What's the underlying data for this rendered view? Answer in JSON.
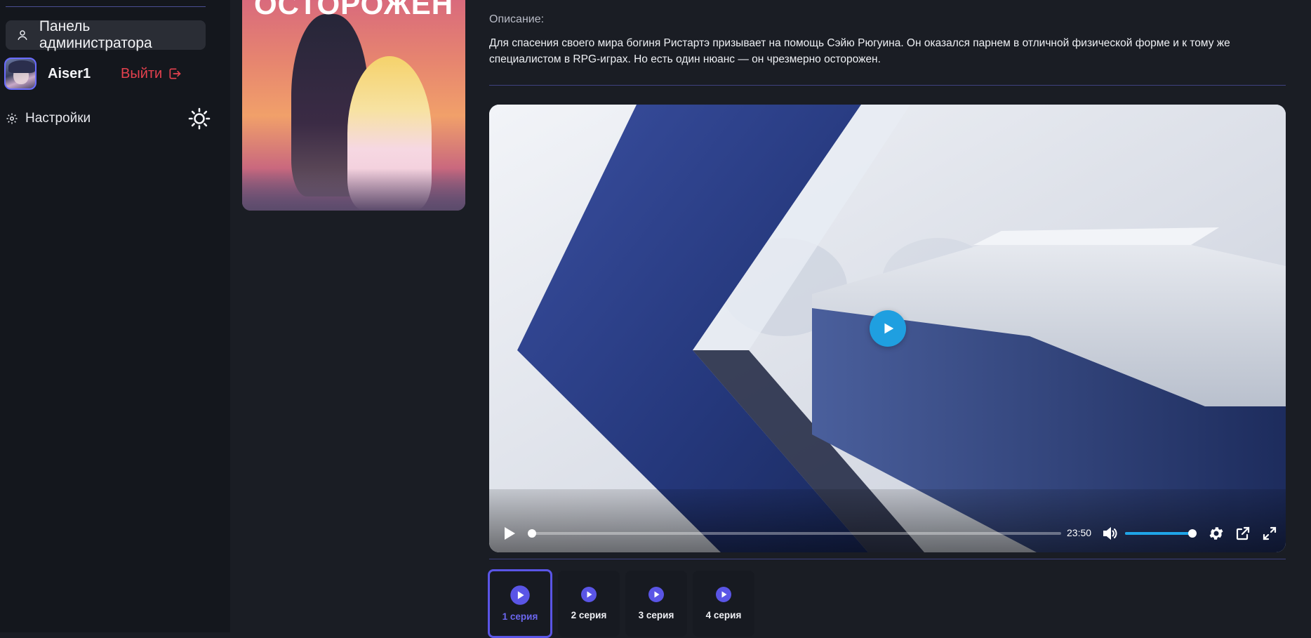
{
  "sidebar": {
    "admin_panel_label": "Панель администратора",
    "user": {
      "name": "Aiser1",
      "logout_label": "Выйти"
    },
    "settings_label": "Настройки"
  },
  "poster": {
    "title_fragment": "ОСТОРОЖЕН"
  },
  "description": {
    "label": "Описание:",
    "text": "Для спасения своего мира богиня Ристартэ призывает на помощь Сэйю Рюгуина. Он оказался парнем в отличной физической форме и к тому же специалистом в RPG-играх. Но есть один нюанс — он чрезмерно осторожен."
  },
  "player": {
    "duration": "23:50",
    "progress_fraction": 0.0,
    "volume_fraction": 1.0,
    "accent_color": "#1f9fe0"
  },
  "episodes": [
    {
      "label": "1 серия",
      "active": true
    },
    {
      "label": "2 серия",
      "active": false
    },
    {
      "label": "3 серия",
      "active": false
    },
    {
      "label": "4 серия",
      "active": false
    }
  ],
  "colors": {
    "accent": "#5a55e6",
    "logout": "#e5414e",
    "background": "#1a1d24",
    "sidebar": "#14171d"
  }
}
